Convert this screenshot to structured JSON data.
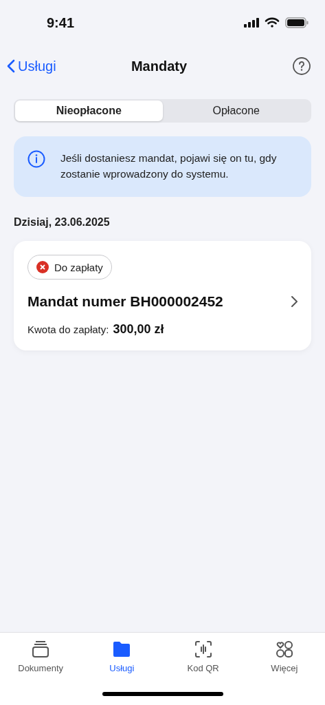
{
  "status_bar": {
    "time": "9:41"
  },
  "nav": {
    "back": "Usługi",
    "title": "Mandaty"
  },
  "segments": [
    {
      "label": "Nieopłacone",
      "selected": true
    },
    {
      "label": "Opłacone",
      "selected": false
    }
  ],
  "info": "Jeśli dostaniesz mandat, pojawi się on tu, gdy zostanie wprowadzony do systemu.",
  "date": "Dzisiaj, 23.06.2025",
  "tickets": [
    {
      "status": "Do zapłaty",
      "kind": "unpaid",
      "title": "Mandat numer BH000002452",
      "amount_label": "Kwota do zapłaty:",
      "amount": "300,00 zł"
    }
  ],
  "tab_bar": [
    {
      "label": "Dokumenty",
      "kind": "documents",
      "selected": false
    },
    {
      "label": "Usługi",
      "kind": "services",
      "selected": true
    },
    {
      "label": "Kod QR",
      "kind": "qr",
      "selected": false
    },
    {
      "label": "Więcej",
      "kind": "more",
      "selected": false
    }
  ]
}
